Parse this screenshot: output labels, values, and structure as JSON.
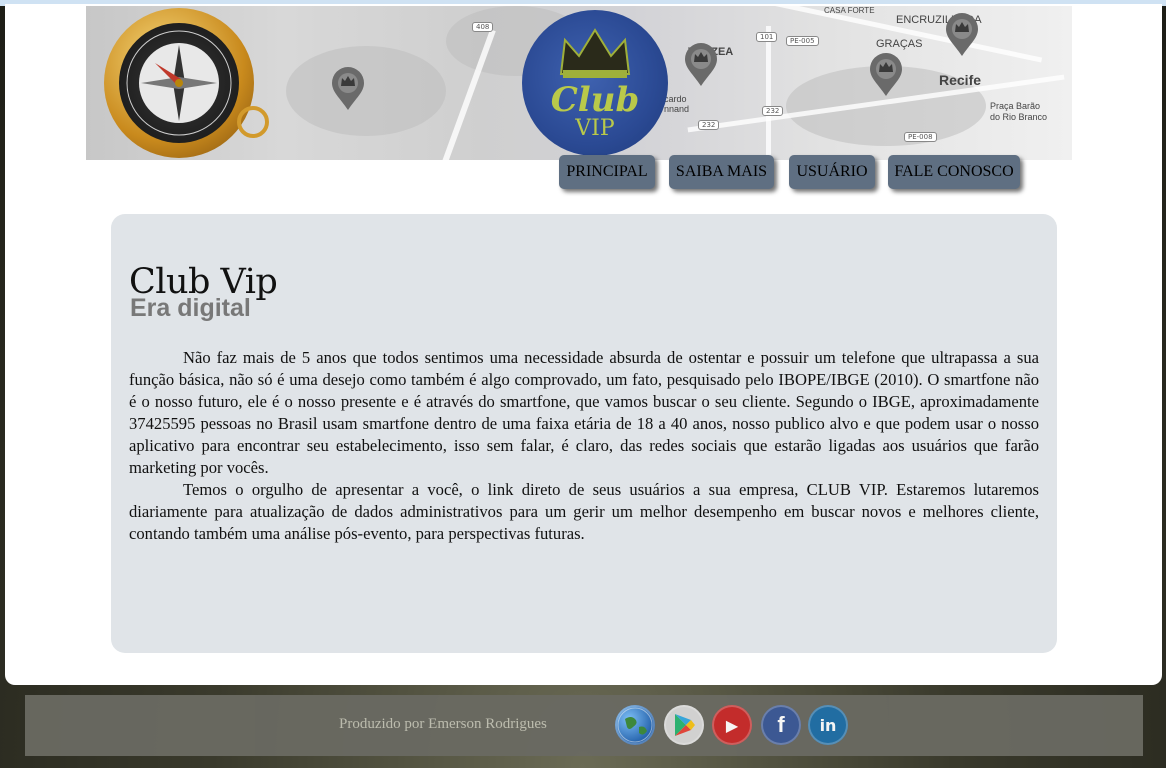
{
  "header": {
    "logo_text_top": "Club",
    "logo_text_bottom": "VIP",
    "map_labels": {
      "casa_forte": "CASA FORTE",
      "encruzilhada": "ENCRUZILHADA",
      "gracas": "GRAÇAS",
      "varzea": "VÁRZEA",
      "recife": "Recife",
      "praca_line1": "Praça Barão",
      "praca_line2": "do Rio Branco",
      "road_408": "408",
      "road_101": "101",
      "road_pe005": "PE-005",
      "road_232a": "232",
      "road_232b": "232",
      "road_pe008": "PE-008",
      "partial_1": "cardo",
      "partial_2": "nnand"
    }
  },
  "nav": {
    "items": [
      {
        "label": "PRINCIPAL"
      },
      {
        "label": "SAIBA MAIS"
      },
      {
        "label": "USUÁRIO"
      },
      {
        "label": "FALE CONOSCO"
      }
    ]
  },
  "main": {
    "title": "Club Vip",
    "subtitle": "Era digital",
    "paragraphs": [
      "Não faz mais de 5 anos que todos sentimos uma necessidade absurda de ostentar e possuir um telefone que ultrapassa a sua função básica, não só é uma desejo como também é algo comprovado, um fato, pesquisado pelo IBOPE/IBGE (2010). O smartfone não é o nosso futuro, ele é o nosso presente e é através do smartfone, que vamos buscar o seu cliente. Segundo o IBGE, aproximadamente 37425595 pessoas no Brasil usam smartfone dentro de uma faixa etária de 18 a 40 anos, nosso publico alvo e que podem usar o nosso aplicativo para encontrar seu estabelecimento, isso sem falar, é claro, das redes sociais que estarão ligadas aos usuários que farão marketing por vocês.",
      "Temos o orgulho de apresentar a você, o link direto de seus usuários a sua empresa, CLUB VIP. Estaremos lutaremos diariamente para atualização de dados administrativos para um gerir um melhor desempenho em buscar novos e melhores cliente, contando também uma análise pós-evento, para perspectivas futuras."
    ]
  },
  "footer": {
    "credit": "Produzido por Emerson Rodrigues",
    "social_icons": [
      "globe-icon",
      "google-play-icon",
      "youtube-icon",
      "facebook-icon",
      "linkedin-icon"
    ],
    "social_glyphs": {
      "youtube": "▶",
      "facebook": "f",
      "linkedin": "in"
    }
  },
  "colors": {
    "nav_button": "#5f6f82",
    "content_bg": "#e0e4e8",
    "subtitle": "#787878",
    "logo_bg": "#2b4a94",
    "logo_text": "#b9c94a"
  }
}
